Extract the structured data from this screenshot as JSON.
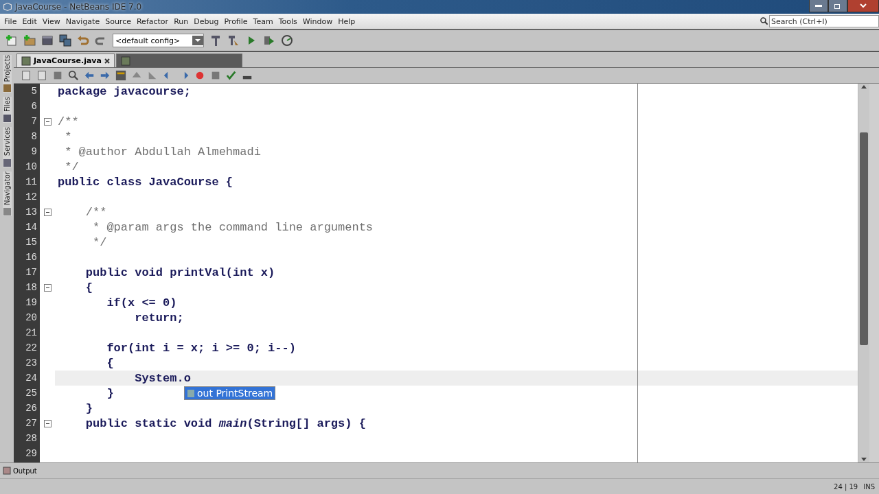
{
  "window": {
    "title": "JavaCourse - NetBeans IDE 7.0"
  },
  "menu": [
    "File",
    "Edit",
    "View",
    "Navigate",
    "Source",
    "Refactor",
    "Run",
    "Debug",
    "Profile",
    "Team",
    "Tools",
    "Window",
    "Help"
  ],
  "search": {
    "placeholder": "Search (Ctrl+I)"
  },
  "toolbar": {
    "config": "<default config>"
  },
  "side_tabs": [
    "Projects",
    "Files",
    "Services",
    "Navigator"
  ],
  "editor_tabs": [
    {
      "label": "JavaCourse.java",
      "selected": true
    },
    {
      "selected": false
    }
  ],
  "editor": {
    "lines": [
      {
        "number": "5",
        "text": "package javacourse;",
        "kind": "code",
        "fold": false,
        "current": false
      },
      {
        "number": "6",
        "fold": false,
        "current": false
      },
      {
        "number": "7",
        "text": "/**",
        "kind": "comment",
        "fold": true,
        "current": false
      },
      {
        "number": "8",
        "text": " *",
        "kind": "comment",
        "fold": false,
        "current": false
      },
      {
        "number": "9",
        "text": " * @author Abdullah Almehmadi",
        "kind": "comment",
        "fold": false,
        "current": false
      },
      {
        "number": "10",
        "text": " */",
        "kind": "comment",
        "fold": false,
        "current": false
      },
      {
        "number": "11",
        "text": "public class JavaCourse {",
        "kind": "code",
        "fold": false,
        "current": false
      },
      {
        "number": "12",
        "fold": false,
        "current": false
      },
      {
        "number": "13",
        "text": "    /**",
        "kind": "comment",
        "fold": true,
        "current": false
      },
      {
        "number": "14",
        "text": "     * @param args the command line arguments",
        "kind": "comment",
        "fold": false,
        "current": false
      },
      {
        "number": "15",
        "text": "     */",
        "kind": "comment",
        "fold": false,
        "current": false
      },
      {
        "number": "16",
        "fold": false,
        "current": false
      },
      {
        "number": "17",
        "text": "    public void printVal(int x)",
        "kind": "code",
        "fold": false,
        "current": false
      },
      {
        "number": "18",
        "text": "    {",
        "kind": "code",
        "fold": true,
        "current": false
      },
      {
        "number": "19",
        "text": "       if(x <= 0)",
        "kind": "code",
        "fold": false,
        "current": false
      },
      {
        "number": "20",
        "text": "           return;",
        "kind": "code",
        "fold": false,
        "current": false
      },
      {
        "number": "21",
        "fold": false,
        "current": false
      },
      {
        "number": "22",
        "text": "       for(int i = x; i >= 0; i--)",
        "kind": "code",
        "fold": false,
        "current": false
      },
      {
        "number": "23",
        "text": "       {",
        "kind": "code",
        "fold": false,
        "current": false
      },
      {
        "number": "24",
        "text": "           System.o",
        "kind": "code",
        "fold": false,
        "current": true
      },
      {
        "number": "25",
        "text": "       }",
        "kind": "code",
        "fold": false,
        "current": false
      },
      {
        "number": "26",
        "text": "    }",
        "kind": "code",
        "fold": false,
        "current": false
      },
      {
        "number": "27",
        "text": "    public static void *main*(String[] args) {",
        "kind": "code",
        "fold": true,
        "current": false
      },
      {
        "number": "28",
        "fold": false,
        "current": false
      },
      {
        "number": "29",
        "fold": false,
        "current": false
      }
    ]
  },
  "completion": {
    "items": [
      {
        "name": "out",
        "type": "PrintStream",
        "selected": true
      }
    ]
  },
  "output_tab": "Output",
  "status": {
    "position": "24 | 19",
    "mode": "INS"
  }
}
